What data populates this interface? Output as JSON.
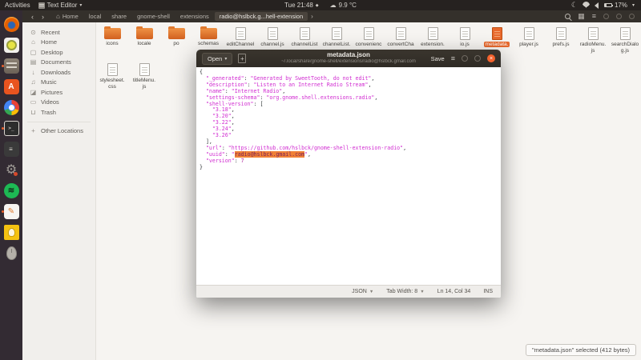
{
  "colors": {
    "accent_orange": "#e8692d",
    "selection_orange": "#f08137",
    "string_magenta": "#d12dd1",
    "close_button": "#f4622d"
  },
  "topbar": {
    "activities": "Activities",
    "app_menu": "Text Editor",
    "clock": "Tue 21:48",
    "weather": "9.9 °C",
    "battery": "17%"
  },
  "dock": {
    "items": [
      {
        "name": "firefox",
        "glyph": "",
        "running": false
      },
      {
        "name": "screenshot-tool",
        "glyph": "",
        "running": false
      },
      {
        "name": "files",
        "glyph": "",
        "running": true
      },
      {
        "name": "ubuntu-software",
        "glyph": "A",
        "running": false
      },
      {
        "name": "chrome",
        "glyph": "",
        "running": false
      },
      {
        "name": "terminal",
        "glyph": ">_",
        "running": true
      },
      {
        "name": "media-player",
        "glyph": "≡",
        "running": false
      },
      {
        "name": "settings",
        "glyph": "⚙",
        "running": false
      },
      {
        "name": "spotify",
        "glyph": "≋",
        "running": false
      },
      {
        "name": "text-editor",
        "glyph": "✎",
        "running": true
      },
      {
        "name": "notes",
        "glyph": "",
        "running": false
      },
      {
        "name": "mouse-device",
        "glyph": "",
        "running": false
      }
    ]
  },
  "files_window": {
    "toolbar": {
      "back": "‹",
      "forward": "›",
      "breadcrumbs": [
        "Home",
        "local",
        "share",
        "gnome-shell",
        "extensions",
        "radio@hslbck.g...hell-extension"
      ],
      "active_index": 5
    },
    "sidebar": {
      "items": [
        {
          "icon": "recent-icon",
          "glyph": "⊙",
          "label": "Recent"
        },
        {
          "icon": "home-icon",
          "glyph": "⌂",
          "label": "Home"
        },
        {
          "icon": "desktop-icon",
          "glyph": "▢",
          "label": "Desktop"
        },
        {
          "icon": "documents-icon",
          "glyph": "▤",
          "label": "Documents"
        },
        {
          "icon": "downloads-icon",
          "glyph": "↓",
          "label": "Downloads"
        },
        {
          "icon": "music-icon",
          "glyph": "♫",
          "label": "Music"
        },
        {
          "icon": "pictures-icon",
          "glyph": "◪",
          "label": "Pictures"
        },
        {
          "icon": "videos-icon",
          "glyph": "▭",
          "label": "Videos"
        },
        {
          "icon": "trash-icon",
          "glyph": "⊔",
          "label": "Trash"
        }
      ],
      "other_locations": "Other Locations",
      "other_glyph": "+"
    },
    "files_row1": [
      {
        "label": "icons",
        "type": "folder"
      },
      {
        "label": "locale",
        "type": "folder"
      },
      {
        "label": "po",
        "type": "folder"
      },
      {
        "label": "schemas",
        "type": "folder"
      },
      {
        "label": "editChannel",
        "type": "file"
      },
      {
        "label": "channel.js",
        "type": "file"
      },
      {
        "label": "channelList",
        "type": "file"
      },
      {
        "label": "channelList.",
        "type": "file"
      },
      {
        "label": "convenienc",
        "type": "file"
      },
      {
        "label": "convertCha",
        "type": "file"
      },
      {
        "label": "extension.",
        "type": "file"
      },
      {
        "label": "io.js",
        "type": "file"
      },
      {
        "label": "metadata.",
        "type": "file",
        "selected": true
      },
      {
        "label": "player.js",
        "type": "file"
      },
      {
        "label": "prefs.js",
        "type": "file"
      },
      {
        "label": "radioMenu.",
        "label2": "js",
        "type": "file"
      },
      {
        "label": "searchDialo",
        "label2": "g.js",
        "type": "file"
      }
    ],
    "files_row2": [
      {
        "label": "stylesheet.",
        "label2": "css",
        "type": "file"
      },
      {
        "label": "titleMenu.",
        "label2": "js",
        "type": "file"
      }
    ],
    "status_popup": "\"metadata.json\" selected (412 bytes)"
  },
  "editor_window": {
    "open_button": "Open",
    "title": "metadata.json",
    "subtitle": "~/.local/share/gnome-shell/extensions/radio@hslbck.gmail.com",
    "save_button": "Save",
    "statusbar": {
      "language": "JSON",
      "tab_width": "Tab Width: 8",
      "position": "Ln 14, Col 34",
      "mode": "INS"
    },
    "code_lines": [
      [
        [
          "p",
          "{"
        ]
      ],
      [
        [
          "p",
          "  "
        ],
        [
          "s",
          "\"_generated\""
        ],
        [
          "p",
          ": "
        ],
        [
          "s",
          "\"Generated by SweetTooth, do not edit\""
        ],
        [
          "p",
          ","
        ]
      ],
      [
        [
          "p",
          "  "
        ],
        [
          "s",
          "\"description\""
        ],
        [
          "p",
          ": "
        ],
        [
          "s",
          "\"Listen to an Internet Radio Stream\""
        ],
        [
          "p",
          ","
        ]
      ],
      [
        [
          "p",
          "  "
        ],
        [
          "s",
          "\"name\""
        ],
        [
          "p",
          ": "
        ],
        [
          "s",
          "\"Internet Radio\""
        ],
        [
          "p",
          ","
        ]
      ],
      [
        [
          "p",
          "  "
        ],
        [
          "s",
          "\"settings-schema\""
        ],
        [
          "p",
          ": "
        ],
        [
          "s",
          "\"org.gnome.shell.extensions.radio\""
        ],
        [
          "p",
          ","
        ]
      ],
      [
        [
          "p",
          "  "
        ],
        [
          "s",
          "\"shell-version\""
        ],
        [
          "p",
          ": ["
        ]
      ],
      [
        [
          "p",
          "    "
        ],
        [
          "s",
          "\"3.18\""
        ],
        [
          "p",
          ","
        ]
      ],
      [
        [
          "p",
          "    "
        ],
        [
          "s",
          "\"3.20\""
        ],
        [
          "p",
          ","
        ]
      ],
      [
        [
          "p",
          "    "
        ],
        [
          "s",
          "\"3.22\""
        ],
        [
          "p",
          ","
        ]
      ],
      [
        [
          "p",
          "    "
        ],
        [
          "s",
          "\"3.24\""
        ],
        [
          "p",
          ","
        ]
      ],
      [
        [
          "p",
          "    "
        ],
        [
          "s",
          "\"3.26\""
        ]
      ],
      [
        [
          "p",
          "  ],"
        ]
      ],
      [
        [
          "p",
          "  "
        ],
        [
          "s",
          "\"url\""
        ],
        [
          "p",
          ": "
        ],
        [
          "s",
          "\"https://github.com/hslbck/gnome-shell-extension-radio\""
        ],
        [
          "p",
          ","
        ]
      ],
      [
        [
          "p",
          "  "
        ],
        [
          "s",
          "\"uuid\""
        ],
        [
          "p",
          ": "
        ],
        [
          "s",
          "\""
        ],
        [
          "sel",
          "radio@hslbck.gmail.com"
        ],
        [
          "s",
          "\""
        ],
        [
          "p",
          ","
        ]
      ],
      [
        [
          "p",
          "  "
        ],
        [
          "s",
          "\"version\""
        ],
        [
          "p",
          ": "
        ],
        [
          "n",
          "7"
        ]
      ],
      [
        [
          "p",
          "}"
        ]
      ]
    ]
  }
}
